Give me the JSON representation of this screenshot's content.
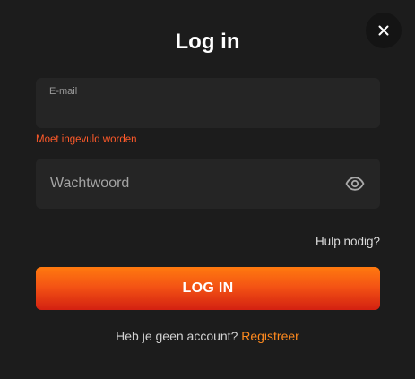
{
  "modal": {
    "title": "Log in",
    "close_icon": "close-icon"
  },
  "email": {
    "label": "E-mail",
    "value": "",
    "error": "Moet ingevuld worden"
  },
  "password": {
    "placeholder": "Wachtwoord",
    "value": "",
    "toggle_icon": "eye-icon"
  },
  "help_link": "Hulp nodig?",
  "login_button": "LOG IN",
  "footer": {
    "prompt": "Heb je geen account?",
    "register_link": "Registreer"
  },
  "colors": {
    "background": "#1c1c1c",
    "field_background": "#252525",
    "error": "#ff5a2a",
    "accent": "#ff8a1e",
    "button_gradient_top": "#ff7a0f",
    "button_gradient_bottom": "#d32011"
  }
}
